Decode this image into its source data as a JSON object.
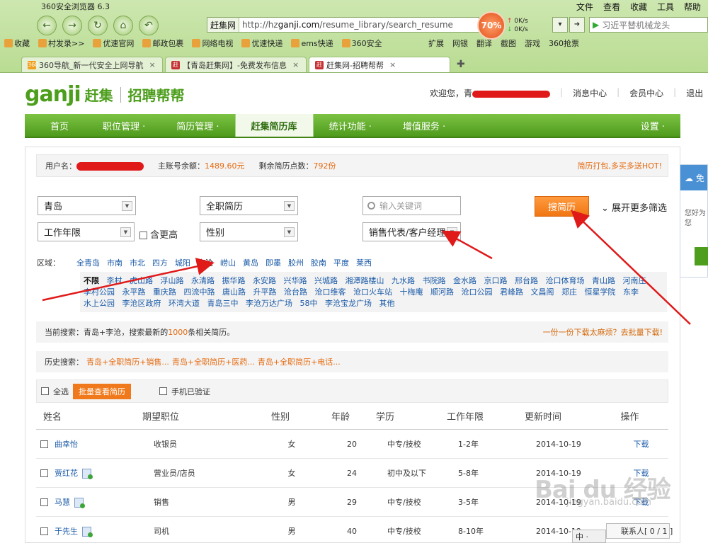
{
  "browser": {
    "title": "360安全浏览器 6.3",
    "menu": [
      "文件",
      "查看",
      "收藏",
      "工具",
      "帮助"
    ],
    "address_site": "赶集网",
    "address_url_prefix": "http://hz",
    "address_url_domain": "ganji.com",
    "address_url_rest": "/resume_library/search_resume",
    "speed_percent": "70%",
    "up_rate": "0K/s",
    "down_rate": "0K/s",
    "search_text": "习近平替机械龙头",
    "favorites": [
      "收藏",
      "村发录>>",
      "优速官网",
      "邮政包裹",
      "网络电视",
      "优速快递",
      "ems快递",
      "360安全"
    ],
    "favorites_right": [
      "扩展",
      "网银",
      "翻译",
      "截图",
      "游戏",
      "360抢票"
    ],
    "tabs": [
      {
        "label": "360导航_新一代安全上网导航",
        "icon": "360"
      },
      {
        "label": "【青岛赶集网】-免费发布信息",
        "icon": "赶"
      },
      {
        "label": "赶集网-招聘帮帮",
        "icon": "赶"
      }
    ]
  },
  "site": {
    "logo_en": "ganji",
    "logo_cn": "赶集",
    "logo_sub": "招聘帮帮",
    "welcome": "欢迎您，青",
    "links": [
      "消息中心",
      "会员中心",
      "退出"
    ]
  },
  "nav": {
    "items": [
      "首页",
      "职位管理 ·",
      "简历管理 ·",
      "赶集简历库",
      "统计功能 ·",
      "增值服务 ·"
    ],
    "settings": "设置 ·"
  },
  "account": {
    "user_label": "用户名：",
    "balance_label": "主账号余额：",
    "balance_value": "1489.60元",
    "points_label": "剩余简历点数：",
    "points_value": "792份",
    "hot": "简历打包,多买多送HOT!"
  },
  "filters": {
    "city": "青岛",
    "type": "全职简历",
    "keyword_placeholder": "输入关键词",
    "years": "工作年限",
    "include_higher": "含更高",
    "gender": "性别",
    "job": "销售代表/客户经理",
    "search_button": "搜简历",
    "more_filters": "展开更多筛选"
  },
  "region": {
    "label": "区域：",
    "cities": [
      "全青岛",
      "市南",
      "市北",
      "四方",
      "城阳",
      "李沧",
      "崂山",
      "黄岛",
      "即墨",
      "胶州",
      "胶南",
      "平度",
      "莱西"
    ],
    "no_limit": "不限",
    "streets": [
      "李村",
      "虎山路",
      "浮山路",
      "永清路",
      "振华路",
      "永安路",
      "兴华路",
      "兴城路",
      "湘潭路楼山",
      "九水路",
      "书院路",
      "金水路",
      "京口路",
      "邢台路",
      "沧口体育场",
      "青山路",
      "河南庄",
      "李村公园",
      "永平路",
      "重庆路",
      "四流中路",
      "唐山路",
      "升平路",
      "沧台路",
      "沧口维客",
      "沧口火车站",
      "十梅庵",
      "顺河路",
      "沧口公园",
      "君峰路",
      "文昌阁",
      "郑庄",
      "恒星学院",
      "东李",
      "水上公园",
      "李沧区政府",
      "环湾大道",
      "青岛三中",
      "李沧万达广场",
      "58中",
      "李沧宝龙广场",
      "其他"
    ]
  },
  "current_search": {
    "prefix": "当前搜索：青岛+李沧，搜索最新的",
    "count": "1000",
    "suffix": "条相关简历。",
    "right": "一份一份下载太麻烦？去批量下载!"
  },
  "history": {
    "label": "历史搜索：",
    "items": [
      "青岛+全职简历+销售...",
      "青岛+全职简历+医药...",
      "青岛+全职简历+电话..."
    ]
  },
  "table": {
    "select_all": "全选",
    "batch_view": "批量查看简历",
    "phone_verified": "手机已验证",
    "headers": [
      "姓名",
      "期望职位",
      "性别",
      "年龄",
      "学历",
      "工作年限",
      "更新时间",
      "操作"
    ],
    "rows": [
      {
        "name": "曲幸怡",
        "job": "收银员",
        "gender": "女",
        "age": "20",
        "edu": "中专/技校",
        "years": "1-2年",
        "updated": "2014-10-19",
        "action": "下载"
      },
      {
        "name": "贾红花",
        "job": "营业员/店员",
        "gender": "女",
        "age": "24",
        "edu": "初中及以下",
        "years": "5-8年",
        "updated": "2014-10-19",
        "action": "下载"
      },
      {
        "name": "马慧",
        "job": "销售",
        "gender": "男",
        "age": "29",
        "edu": "中专/技校",
        "years": "3-5年",
        "updated": "2014-10-19",
        "action": "下载"
      },
      {
        "name": "于先生",
        "job": "司机",
        "gender": "男",
        "age": "40",
        "edu": "中专/技校",
        "years": "8-10年",
        "updated": "2014-10-19",
        "action": "下载"
      }
    ]
  },
  "side_card": {
    "top": "免",
    "text": "您好为您"
  },
  "watermark": {
    "big": "Bai du 经验",
    "small": "jingyan.baidu.com"
  },
  "chat": {
    "label": "联系人[ 0 / 1 ]"
  },
  "ime": {
    "label": "中 ·"
  },
  "colors": {
    "green": "#4e9a1c",
    "orange": "#f07612",
    "link": "#1a5aa8",
    "annotation": "#e01919"
  }
}
